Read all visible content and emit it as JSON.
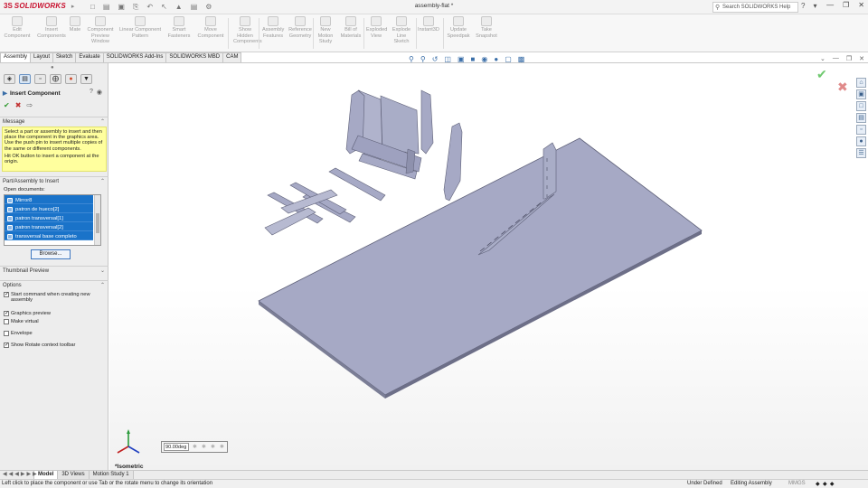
{
  "app": {
    "brand_ds": "3S",
    "brand_name": "SOLIDWORKS",
    "document_title": "assembly-flat *",
    "search_placeholder": "Search SOLIDWORKS Help"
  },
  "ribbon": {
    "buttons": [
      {
        "label": "Edit\nComponent"
      },
      {
        "label": "Insert\nComponents"
      },
      {
        "label": "Mate"
      },
      {
        "label": "Component\nPreview\nWindow"
      },
      {
        "label": "Linear Component\nPattern"
      },
      {
        "label": "Smart\nFasteners"
      },
      {
        "label": "Move\nComponent"
      },
      {
        "label": "Show\nHidden\nComponents"
      },
      {
        "label": "Assembly\nFeatures"
      },
      {
        "label": "Reference\nGeometry"
      },
      {
        "label": "New\nMotion\nStudy"
      },
      {
        "label": "Bill of\nMaterials"
      },
      {
        "label": "Exploded\nView"
      },
      {
        "label": "Explode\nLine\nSketch"
      },
      {
        "label": "Instant3D"
      },
      {
        "label": "Update\nSpeedpak"
      },
      {
        "label": "Take\nSnapshot"
      }
    ]
  },
  "tabs": [
    "Assembly",
    "Layout",
    "Sketch",
    "Evaluate",
    "SOLIDWORKS Add-Ins",
    "SOLIDWORKS MBD",
    "CAM"
  ],
  "property_manager": {
    "title": "Insert Component",
    "message_header": "Message",
    "message_p1": "Select a part or assembly to insert and then place the component in the graphics area. Use the push pin to insert multiple copies of the same or different components.",
    "message_p2": "Hit OK button to insert a component at the origin.",
    "part_header": "Part/Assembly to Insert",
    "open_documents_label": "Open documents:",
    "documents": [
      "Mirror8",
      "patron de hueco[2]",
      "patron transversal[1]",
      "patron transversal[2]",
      "transversal base completo"
    ],
    "browse_label": "Browse...",
    "thumbnail_header": "Thumbnail Preview",
    "options_header": "Options",
    "options": [
      {
        "label": "Start command when creating new assembly",
        "checked": true
      },
      {
        "label": "Graphics preview",
        "checked": true
      },
      {
        "label": "Make virtual",
        "checked": false
      },
      {
        "label": "Envelope",
        "checked": false
      },
      {
        "label": "Show Rotate context toolbar",
        "checked": true
      }
    ]
  },
  "viewport": {
    "rotate_value": "90.00deg",
    "view_label": "*Isometric"
  },
  "bottom_tabs": [
    "Model",
    "3D Views",
    "Motion Study 1"
  ],
  "status": {
    "message": "Left click to place the component or use Tab or the rotate menu to change its orientation",
    "definition": "Under Defined",
    "mode": "Editing Assembly",
    "units": "MMGS"
  },
  "colors": {
    "selection_blue": "#1a73c9",
    "message_yellow": "#ffff9e",
    "part_fill": "#a5a8c4",
    "brand_red": "#c8102e"
  }
}
